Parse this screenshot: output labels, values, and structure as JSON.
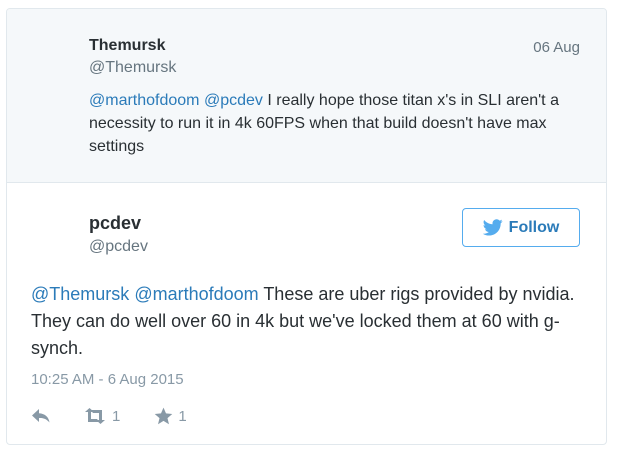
{
  "parent_tweet": {
    "name": "Themursk",
    "handle": "@Themursk",
    "date": "06 Aug",
    "mentions": [
      "@marthofdoom",
      "@pcdev"
    ],
    "text": " I really hope those titan x's in SLI aren't a necessity to run it in 4k 60FPS when that build doesn't have max settings"
  },
  "main_tweet": {
    "name": "pcdev",
    "handle": "@pcdev",
    "follow_label": "Follow",
    "mentions": [
      "@Themursk",
      "@marthofdoom"
    ],
    "text": " These are uber rigs provided by nvidia. They can do well over 60 in 4k but we've locked them at 60 with g-synch.",
    "timestamp": "10:25 AM - 6 Aug 2015",
    "retweet_count": "1",
    "favorite_count": "1"
  },
  "icons": {
    "follow": "twitter-bird-icon",
    "reply": "reply-icon",
    "retweet": "retweet-icon",
    "favorite": "star-icon"
  },
  "colors": {
    "link": "#2b7bb9",
    "follow_border": "#55acee",
    "muted": "#8899a6",
    "parent_background": "#f5f8fa"
  }
}
